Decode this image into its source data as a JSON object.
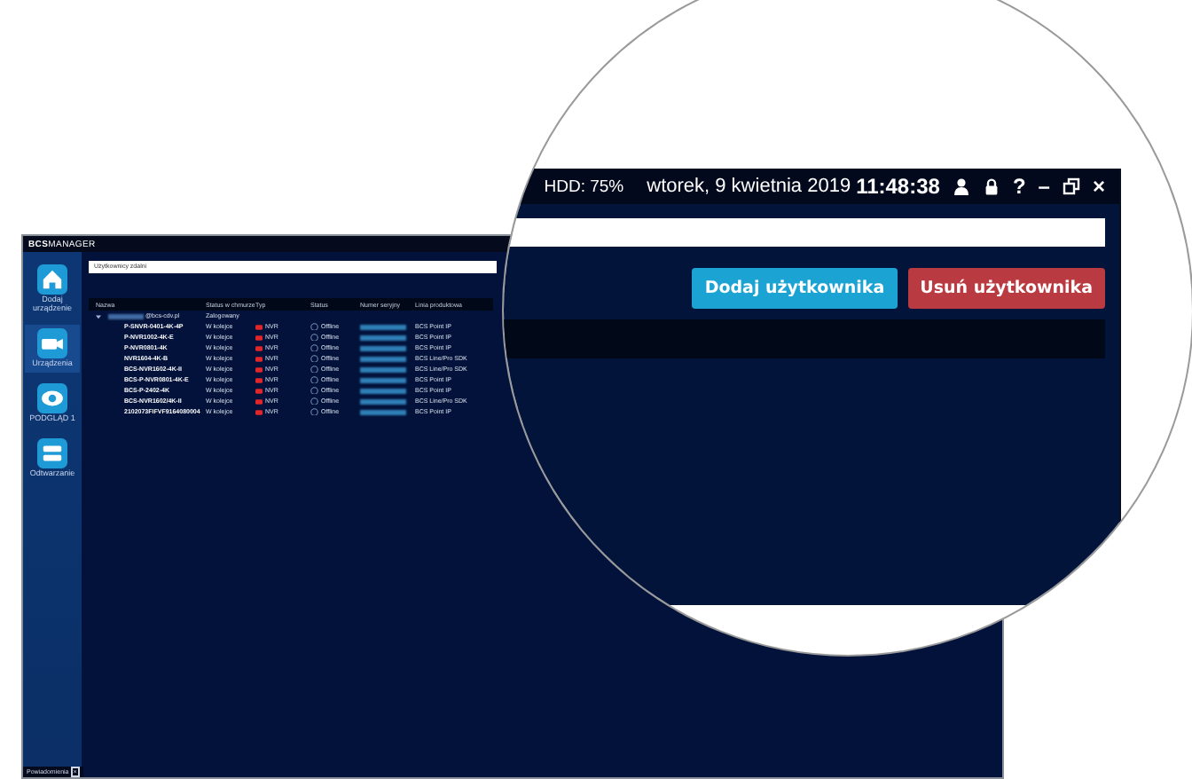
{
  "app": {
    "logo_bold": "BCS",
    "logo_text": "MANAGER"
  },
  "sidebar": {
    "items": [
      {
        "label": "Dodaj urządzenie",
        "selected": false
      },
      {
        "label": "Urządzenia",
        "selected": true
      },
      {
        "label": "PODGLĄD 1",
        "selected": false
      },
      {
        "label": "Odtwarzanie",
        "selected": false
      }
    ],
    "notifications_tab": {
      "label": "Powiadomienia",
      "close": "×"
    }
  },
  "search": {
    "value": "Użytkownicy zdalni"
  },
  "table": {
    "columns": [
      "Nazwa",
      "Status w chmurze",
      "Typ",
      "Status",
      "Numer seryjny",
      "Linia produktowa"
    ],
    "rows": [
      {
        "kind": "group",
        "name": "@bcs-cdv.pl",
        "cloud_status": "Zalogowany",
        "expanded": true,
        "children": [
          {
            "kind": "device",
            "name": "P-SNVR-0401-4K-4P",
            "cloud_status": "W kolejce",
            "type": "NVR",
            "status": "Offline",
            "line": "BCS Point IP"
          },
          {
            "kind": "device",
            "name": "P-NVR1002-4K-E",
            "cloud_status": "W kolejce",
            "type": "NVR",
            "status": "Offline",
            "line": "BCS Point IP"
          },
          {
            "kind": "device",
            "name": "P-NVR0801-4K",
            "cloud_status": "W kolejce",
            "type": "NVR",
            "status": "Offline",
            "line": "BCS Point IP"
          },
          {
            "kind": "device",
            "name": "NVR1604-4K-B",
            "cloud_status": "W kolejce",
            "type": "NVR",
            "status": "Offline",
            "line": "BCS Line/Pro SDK"
          },
          {
            "kind": "device",
            "name": "BCS-NVR1602-4K-II",
            "cloud_status": "W kolejce",
            "type": "NVR",
            "status": "Offline",
            "line": "BCS Line/Pro SDK"
          },
          {
            "kind": "device",
            "name": "BCS-P-NVR0801-4K-E",
            "cloud_status": "W kolejce",
            "type": "NVR",
            "status": "Offline",
            "line": "BCS Point IP"
          },
          {
            "kind": "device",
            "name": "BCS-P-2402-4K",
            "cloud_status": "W kolejce",
            "type": "NVR",
            "status": "Offline",
            "line": "BCS Point IP"
          },
          {
            "kind": "device",
            "name": "BCS-NVR1602/4K-II",
            "cloud_status": "W kolejce",
            "type": "NVR",
            "status": "Offline",
            "line": "BCS Line/Pro SDK"
          },
          {
            "kind": "device",
            "name": "2102073FIFVF9164080004",
            "cloud_status": "W kolejce",
            "type": "NVR",
            "status": "Offline",
            "line": "BCS Point IP"
          }
        ]
      }
    ]
  },
  "magnified": {
    "hdd": "HDD: 75%",
    "date": "wtorek, 9 kwietnia 2019",
    "time": "11:48:38",
    "help": "?",
    "minimize": "–",
    "close": "×",
    "buttons": [
      {
        "label": "Dodaj użytkownika",
        "kind": "primary"
      },
      {
        "label": "Usuń użytkownika",
        "kind": "danger"
      }
    ]
  }
}
